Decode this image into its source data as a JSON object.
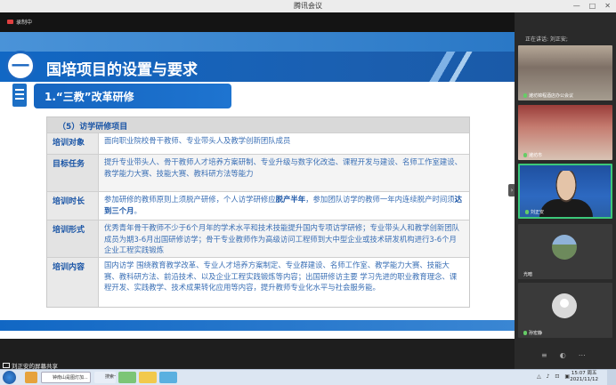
{
  "window": {
    "title": "腾讯会议",
    "controls": [
      "—",
      "□",
      "✕"
    ]
  },
  "recording": {
    "label": "录制中",
    "color": "#e04040"
  },
  "slide": {
    "chapter_number": "一",
    "chapter_title": "国培项目的设置与要求",
    "section_title": "1.“三教”改革研修",
    "table": {
      "caption": "（5）访学研修项目",
      "rows": [
        {
          "label": "培训对象",
          "text": "面向职业院校骨干教师、专业带头人及教学创新团队成员"
        },
        {
          "label": "目标任务",
          "text": "提升专业带头人、骨干教师人才培养方案研制、专业升级与数字化改造、课程开发与建设、名师工作室建设、教学能力大赛、技能大赛、教科研方法等能力"
        },
        {
          "label": "培训时长",
          "text_pre1": "参加研修的教师原则上须脱产研修，个人访学研修应",
          "hl1": "脱产半年",
          "text_mid": "，参加团队访学的教师一年内连续脱产时间须",
          "hl2": "达到三个月",
          "text_post": "。"
        },
        {
          "label": "培训形式",
          "text": "优秀青年骨干教师不少于6个月年的学术水平和技术技能提升国内专项访学研修；专业带头人和教学创新团队成员为期3-6月出国研修访学；骨干专业教师作为高级访问工程师到大中型企业或技术研发机构进行3-6个月企业工程实践锻炼"
        },
        {
          "label": "培训内容",
          "text": "国内访学 围绕教育教学改革、专业人才培养方案制定、专业群建设、名师工作室、教学能力大赛、技能大赛、教科研方法、前沿技术、以及企业工程实践锻炼等内容；出国研修访主要 学习先进的职业教育理念、课程开发、实践教学、技术成果转化应用等内容，提升教师专业化水平与社会服务能。"
        }
      ]
    }
  },
  "share": {
    "label": "刘正安的屏幕共享"
  },
  "panel": {
    "header": "正在讲话: 刘正安;",
    "tiles": [
      {
        "name": "潍坊锦程酒店办公会议"
      },
      {
        "name": "潍坊市"
      },
      {
        "name": "刘正安"
      },
      {
        "name": "光暗"
      },
      {
        "name": "孙宏静"
      }
    ],
    "collapse_glyph": "›",
    "bottom_icons": [
      "≡",
      "◐",
      "⋯"
    ]
  },
  "taskbar": {
    "items": [
      "钟南山是图灯加...",
      "搜索一下",
      "",
      "",
      "",
      ""
    ],
    "tray": "△ ♪ ⊡ ▣",
    "time": "15:07 周五",
    "date": "2021/11/12"
  }
}
